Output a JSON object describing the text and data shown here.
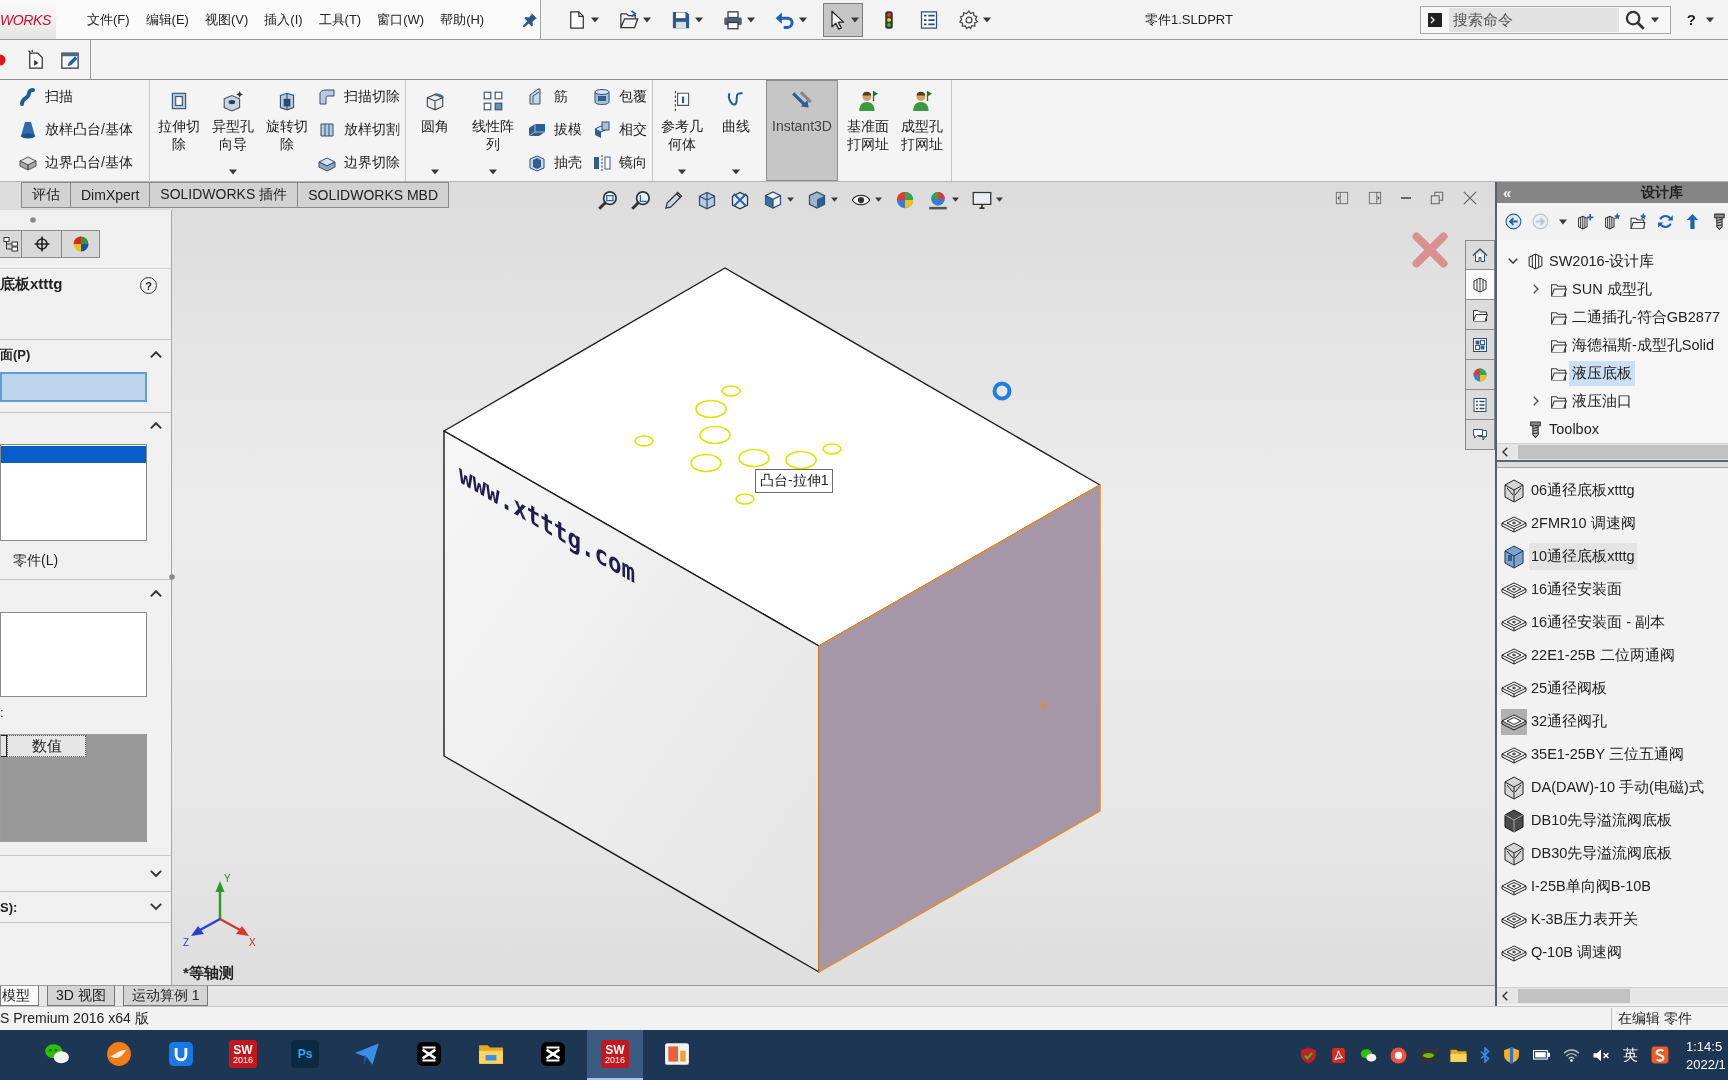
{
  "app_bar": {
    "logo": "WORKS",
    "menu": [
      "文件(F)",
      "编辑(E)",
      "视图(V)",
      "插入(I)",
      "工具(T)",
      "窗口(W)",
      "帮助(H)"
    ],
    "quick_tools": [
      {
        "dropdown": true,
        "selected": false
      },
      {
        "dropdown": true,
        "selected": false
      },
      {
        "dropdown": true,
        "selected": false
      },
      {
        "dropdown": true,
        "selected": false
      },
      {
        "dropdown": true,
        "selected": false
      },
      {
        "dropdown": true,
        "selected": true
      },
      {
        "dropdown": false,
        "selected": false
      },
      {
        "dropdown": false,
        "selected": false
      },
      {
        "dropdown": true,
        "selected": false
      }
    ],
    "document_title": "零件1.SLDPRT",
    "search": {
      "placeholder": "搜索命令"
    },
    "help": "?"
  },
  "ribbon": {
    "groups": [
      {
        "items": [
          {
            "kind": "small",
            "label": "扫描"
          },
          {
            "kind": "small",
            "label": "放样凸台/基体"
          },
          {
            "kind": "small",
            "label": "边界凸台/基体"
          }
        ]
      },
      {
        "items": [
          {
            "kind": "large",
            "label": "拉伸切除",
            "dropdown": false,
            "selected": false
          },
          {
            "kind": "large",
            "label": "异型孔向导",
            "dropdown": true,
            "selected": false
          },
          {
            "kind": "large",
            "label": "旋转切除",
            "dropdown": false,
            "selected": false
          },
          {
            "kind": "small",
            "label": "扫描切除"
          },
          {
            "kind": "small",
            "label": "放样切割"
          },
          {
            "kind": "small",
            "label": "边界切除"
          }
        ]
      },
      {
        "items": [
          {
            "kind": "large",
            "label": "圆角",
            "dropdown": true,
            "selected": false
          },
          {
            "kind": "large",
            "label": "线性阵列",
            "dropdown": true,
            "selected": false
          },
          {
            "kind": "small",
            "label": "筋"
          },
          {
            "kind": "small",
            "label": "拔模"
          },
          {
            "kind": "small",
            "label": "抽壳"
          },
          {
            "kind": "small",
            "label": "包覆"
          },
          {
            "kind": "small",
            "label": "相交"
          },
          {
            "kind": "small",
            "label": "镜向"
          }
        ]
      },
      {
        "items": [
          {
            "kind": "large",
            "label": "参考几何体",
            "dropdown": true,
            "selected": false
          },
          {
            "kind": "large",
            "label": "曲线",
            "dropdown": true,
            "selected": false
          },
          {
            "kind": "large",
            "label": "Instant3D",
            "dropdown": false,
            "selected": true
          },
          {
            "kind": "large",
            "label": "基准面打网址",
            "dropdown": false,
            "selected": false
          },
          {
            "kind": "large",
            "label": "成型孔打网址",
            "dropdown": false,
            "selected": false
          }
        ]
      }
    ]
  },
  "command_tabs": [
    {
      "label": "评估",
      "selected": false
    },
    {
      "label": "DimXpert",
      "selected": false
    },
    {
      "label": "SOLIDWORKS 插件",
      "selected": false
    },
    {
      "label": "SOLIDWORKS MBD",
      "selected": false
    }
  ],
  "graphics": {
    "view_tools": [
      {
        "dropdown": false
      },
      {
        "dropdown": false
      },
      {
        "dropdown": false
      },
      {
        "dropdown": false
      },
      {
        "dropdown": false
      },
      {
        "dropdown": true
      },
      {
        "dropdown": true
      },
      {
        "dropdown": true
      },
      {
        "dropdown": false
      },
      {
        "dropdown": true
      },
      {
        "dropdown": true
      }
    ],
    "faces": [
      {
        "selected": false
      },
      {
        "selected": false
      },
      {
        "selected": true
      }
    ],
    "model_text": "www.xtttg.com",
    "tooltip": "凸台-拉伸1",
    "view_name": "*等轴测",
    "triad": {
      "x": "X",
      "y": "Y",
      "z": "Z"
    }
  },
  "property_manager": {
    "title": "底板xtttg",
    "help": "?",
    "sections": [
      {
        "kind": "selection",
        "label": "面(P)",
        "expanded": true,
        "field_active": true
      },
      {
        "kind": "list",
        "expanded": true,
        "rows": [
          {
            "selected": true
          }
        ],
        "option": "零件(L)"
      },
      {
        "kind": "table",
        "expanded": true,
        "caption": ":",
        "columns": [
          "数值"
        ]
      },
      {
        "kind": "plain",
        "expanded": false
      },
      {
        "kind": "plain",
        "label": "S):",
        "expanded": false
      }
    ]
  },
  "task_pane_tabs": [
    {
      "selected": false
    },
    {
      "selected": true
    },
    {
      "selected": false
    },
    {
      "selected": false
    },
    {
      "selected": false
    },
    {
      "selected": false
    },
    {
      "selected": false
    }
  ],
  "design_library": {
    "collapse": "«",
    "title": "设计库",
    "tools": [
      {
        "disabled": false
      },
      {
        "disabled": true
      },
      {
        "disabled": false
      },
      {
        "disabled": false
      },
      {
        "disabled": false
      },
      {
        "disabled": false
      },
      {
        "disabled": false
      },
      {
        "disabled": false
      }
    ],
    "tree": [
      {
        "kind": "library",
        "label": "SW2016-设计库",
        "has_children": true,
        "expanded": true,
        "selected": false,
        "children": [
          {
            "kind": "folder",
            "label": "SUN 成型孔",
            "has_children": true,
            "expanded": false,
            "selected": false
          },
          {
            "kind": "folder",
            "label": "二通插孔-符合GB2877",
            "has_children": false,
            "selected": false
          },
          {
            "kind": "folder",
            "label": "海德福斯-成型孔Solid",
            "has_children": false,
            "selected": false
          },
          {
            "kind": "folder",
            "label": "液压底板",
            "has_children": false,
            "selected": true
          },
          {
            "kind": "folder",
            "label": "液压油口",
            "has_children": true,
            "expanded": false,
            "selected": false
          }
        ]
      },
      {
        "kind": "toolbox",
        "label": "Toolbox",
        "has_children": false,
        "selected": false
      }
    ],
    "items": [
      {
        "label": "06通径底板xtttg",
        "selected": false
      },
      {
        "label": "2FMR10 调速阀",
        "selected": false
      },
      {
        "label": "10通径底板xtttg",
        "selected": true
      },
      {
        "label": "16通径安装面",
        "selected": false
      },
      {
        "label": "16通径安装面 - 副本",
        "selected": false
      },
      {
        "label": "22E1-25B 二位两通阀",
        "selected": false
      },
      {
        "label": "25通径阀板",
        "selected": false
      },
      {
        "label": "32通径阀孔",
        "selected": false
      },
      {
        "label": "35E1-25BY 三位五通阀",
        "selected": false
      },
      {
        "label": "DA(DAW)-10 手动(电磁)式",
        "selected": false
      },
      {
        "label": "DB10先导溢流阀底板",
        "selected": false
      },
      {
        "label": "DB30先导溢流阀底板",
        "selected": false
      },
      {
        "label": "I-25B单向阀B-10B",
        "selected": false
      },
      {
        "label": "K-3B压力表开关",
        "selected": false
      },
      {
        "label": "Q-10B 调速阀",
        "selected": false
      }
    ]
  },
  "model_tabs": [
    {
      "label": "模型",
      "selected": true
    },
    {
      "label": "3D 视图",
      "selected": false
    },
    {
      "label": "运动算例 1",
      "selected": false
    }
  ],
  "status_bar": {
    "product": "S Premium 2016 x64 版",
    "mode": "在编辑 零件"
  },
  "taskbar": {
    "apps": [
      {
        "selected": false
      },
      {
        "selected": false
      },
      {
        "selected": false
      },
      {
        "label": "SW",
        "sublabel": "2016",
        "selected": false
      },
      {
        "label": "Ps",
        "selected": false
      },
      {
        "selected": false
      },
      {
        "selected": false
      },
      {
        "selected": false
      },
      {
        "selected": false
      },
      {
        "label": "SW",
        "sublabel": "2016",
        "selected": true
      },
      {
        "selected": false
      }
    ],
    "ime": "英",
    "time": "1:14:5",
    "date": "2022/1"
  }
}
